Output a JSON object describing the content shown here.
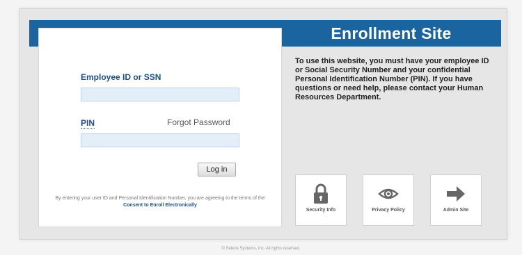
{
  "header": {
    "title": "Enrollment Site"
  },
  "login": {
    "employee_label": "Employee ID or SSN",
    "employee_value": "",
    "pin_label": "PIN",
    "pin_value": "",
    "forgot_link": "Forgot Password",
    "login_button": "Log in",
    "disclaimer_prefix": "By entering your user ID and Personal Identification Number, you are agreeing to the terms of the",
    "disclaimer_link": "Consent to Enroll Electronically"
  },
  "info_text": "To use this website, you must have your employee ID or Social Security Number and your confidential Personal Identification Number (PIN). If you have questions or need help, please contact your Human Resources Department.",
  "tiles": [
    {
      "label": "Security Info",
      "icon": "lock-icon"
    },
    {
      "label": "Privacy Policy",
      "icon": "eye-icon"
    },
    {
      "label": "Admin Site",
      "icon": "arrow-right-icon"
    }
  ],
  "footer": {
    "copyright": "© Selerix Systems, Inc. All rights reserved."
  },
  "colors": {
    "brand": "#1a64a0",
    "label": "#1f4f86",
    "input_bg": "#e4eef8"
  }
}
